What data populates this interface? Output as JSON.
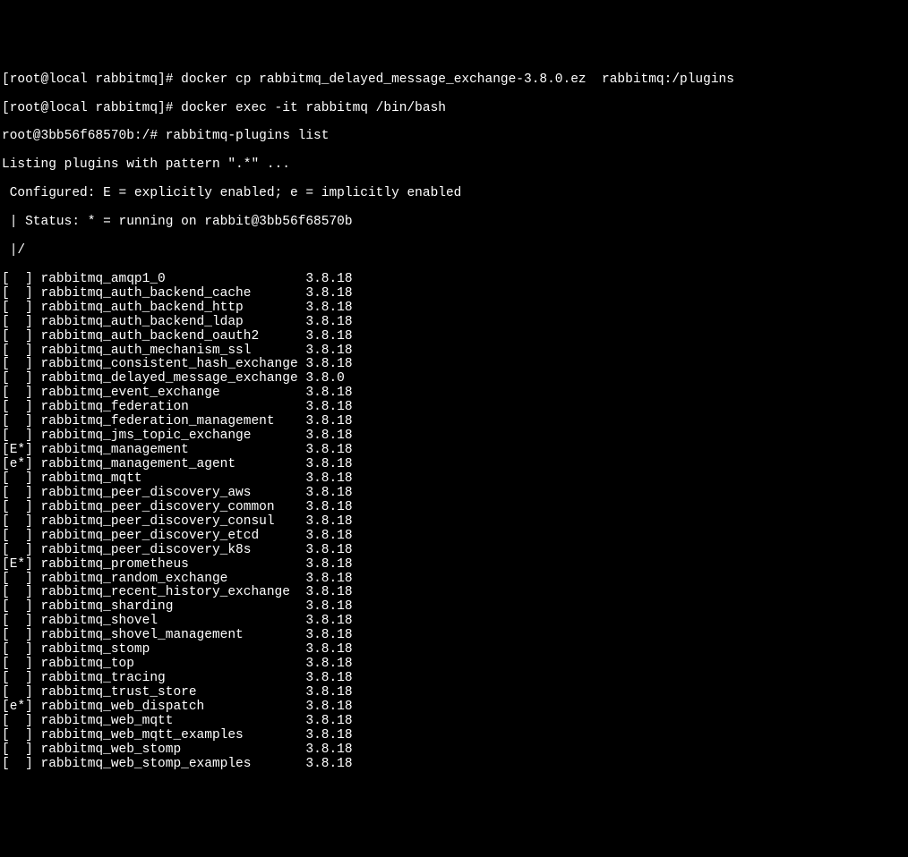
{
  "prompt1": {
    "user_host": "[root@local rabbitmq]# ",
    "command": "docker cp rabbitmq_delayed_message_exchange-3.8.0.ez  rabbitmq:/plugins"
  },
  "prompt2": {
    "user_host": "[root@local rabbitmq]# ",
    "command": "docker exec -it rabbitmq /bin/bash"
  },
  "prompt3": {
    "user_host": "root@3bb56f68570b:/# ",
    "command": "rabbitmq-plugins list"
  },
  "header": {
    "listing": "Listing plugins with pattern \".*\" ...",
    "configured": " Configured: E = explicitly enabled; e = implicitly enabled",
    "status": " | Status: * = running on rabbit@3bb56f68570b",
    "divider": " |/"
  },
  "plugins": [
    {
      "status": "[  ]",
      "name": "rabbitmq_amqp1_0",
      "version": "3.8.18"
    },
    {
      "status": "[  ]",
      "name": "rabbitmq_auth_backend_cache",
      "version": "3.8.18"
    },
    {
      "status": "[  ]",
      "name": "rabbitmq_auth_backend_http",
      "version": "3.8.18"
    },
    {
      "status": "[  ]",
      "name": "rabbitmq_auth_backend_ldap",
      "version": "3.8.18"
    },
    {
      "status": "[  ]",
      "name": "rabbitmq_auth_backend_oauth2",
      "version": "3.8.18"
    },
    {
      "status": "[  ]",
      "name": "rabbitmq_auth_mechanism_ssl",
      "version": "3.8.18"
    },
    {
      "status": "[  ]",
      "name": "rabbitmq_consistent_hash_exchange",
      "version": "3.8.18"
    },
    {
      "status": "[  ]",
      "name": "rabbitmq_delayed_message_exchange",
      "version": "3.8.0"
    },
    {
      "status": "[  ]",
      "name": "rabbitmq_event_exchange",
      "version": "3.8.18"
    },
    {
      "status": "[  ]",
      "name": "rabbitmq_federation",
      "version": "3.8.18"
    },
    {
      "status": "[  ]",
      "name": "rabbitmq_federation_management",
      "version": "3.8.18"
    },
    {
      "status": "[  ]",
      "name": "rabbitmq_jms_topic_exchange",
      "version": "3.8.18"
    },
    {
      "status": "[E*]",
      "name": "rabbitmq_management",
      "version": "3.8.18"
    },
    {
      "status": "[e*]",
      "name": "rabbitmq_management_agent",
      "version": "3.8.18"
    },
    {
      "status": "[  ]",
      "name": "rabbitmq_mqtt",
      "version": "3.8.18"
    },
    {
      "status": "[  ]",
      "name": "rabbitmq_peer_discovery_aws",
      "version": "3.8.18"
    },
    {
      "status": "[  ]",
      "name": "rabbitmq_peer_discovery_common",
      "version": "3.8.18"
    },
    {
      "status": "[  ]",
      "name": "rabbitmq_peer_discovery_consul",
      "version": "3.8.18"
    },
    {
      "status": "[  ]",
      "name": "rabbitmq_peer_discovery_etcd",
      "version": "3.8.18"
    },
    {
      "status": "[  ]",
      "name": "rabbitmq_peer_discovery_k8s",
      "version": "3.8.18"
    },
    {
      "status": "[E*]",
      "name": "rabbitmq_prometheus",
      "version": "3.8.18"
    },
    {
      "status": "[  ]",
      "name": "rabbitmq_random_exchange",
      "version": "3.8.18"
    },
    {
      "status": "[  ]",
      "name": "rabbitmq_recent_history_exchange",
      "version": "3.8.18"
    },
    {
      "status": "[  ]",
      "name": "rabbitmq_sharding",
      "version": "3.8.18"
    },
    {
      "status": "[  ]",
      "name": "rabbitmq_shovel",
      "version": "3.8.18"
    },
    {
      "status": "[  ]",
      "name": "rabbitmq_shovel_management",
      "version": "3.8.18"
    },
    {
      "status": "[  ]",
      "name": "rabbitmq_stomp",
      "version": "3.8.18"
    },
    {
      "status": "[  ]",
      "name": "rabbitmq_top",
      "version": "3.8.18"
    },
    {
      "status": "[  ]",
      "name": "rabbitmq_tracing",
      "version": "3.8.18"
    },
    {
      "status": "[  ]",
      "name": "rabbitmq_trust_store",
      "version": "3.8.18"
    },
    {
      "status": "[e*]",
      "name": "rabbitmq_web_dispatch",
      "version": "3.8.18"
    },
    {
      "status": "[  ]",
      "name": "rabbitmq_web_mqtt",
      "version": "3.8.18"
    },
    {
      "status": "[  ]",
      "name": "rabbitmq_web_mqtt_examples",
      "version": "3.8.18"
    },
    {
      "status": "[  ]",
      "name": "rabbitmq_web_stomp",
      "version": "3.8.18"
    },
    {
      "status": "[  ]",
      "name": "rabbitmq_web_stomp_examples",
      "version": "3.8.18"
    }
  ]
}
